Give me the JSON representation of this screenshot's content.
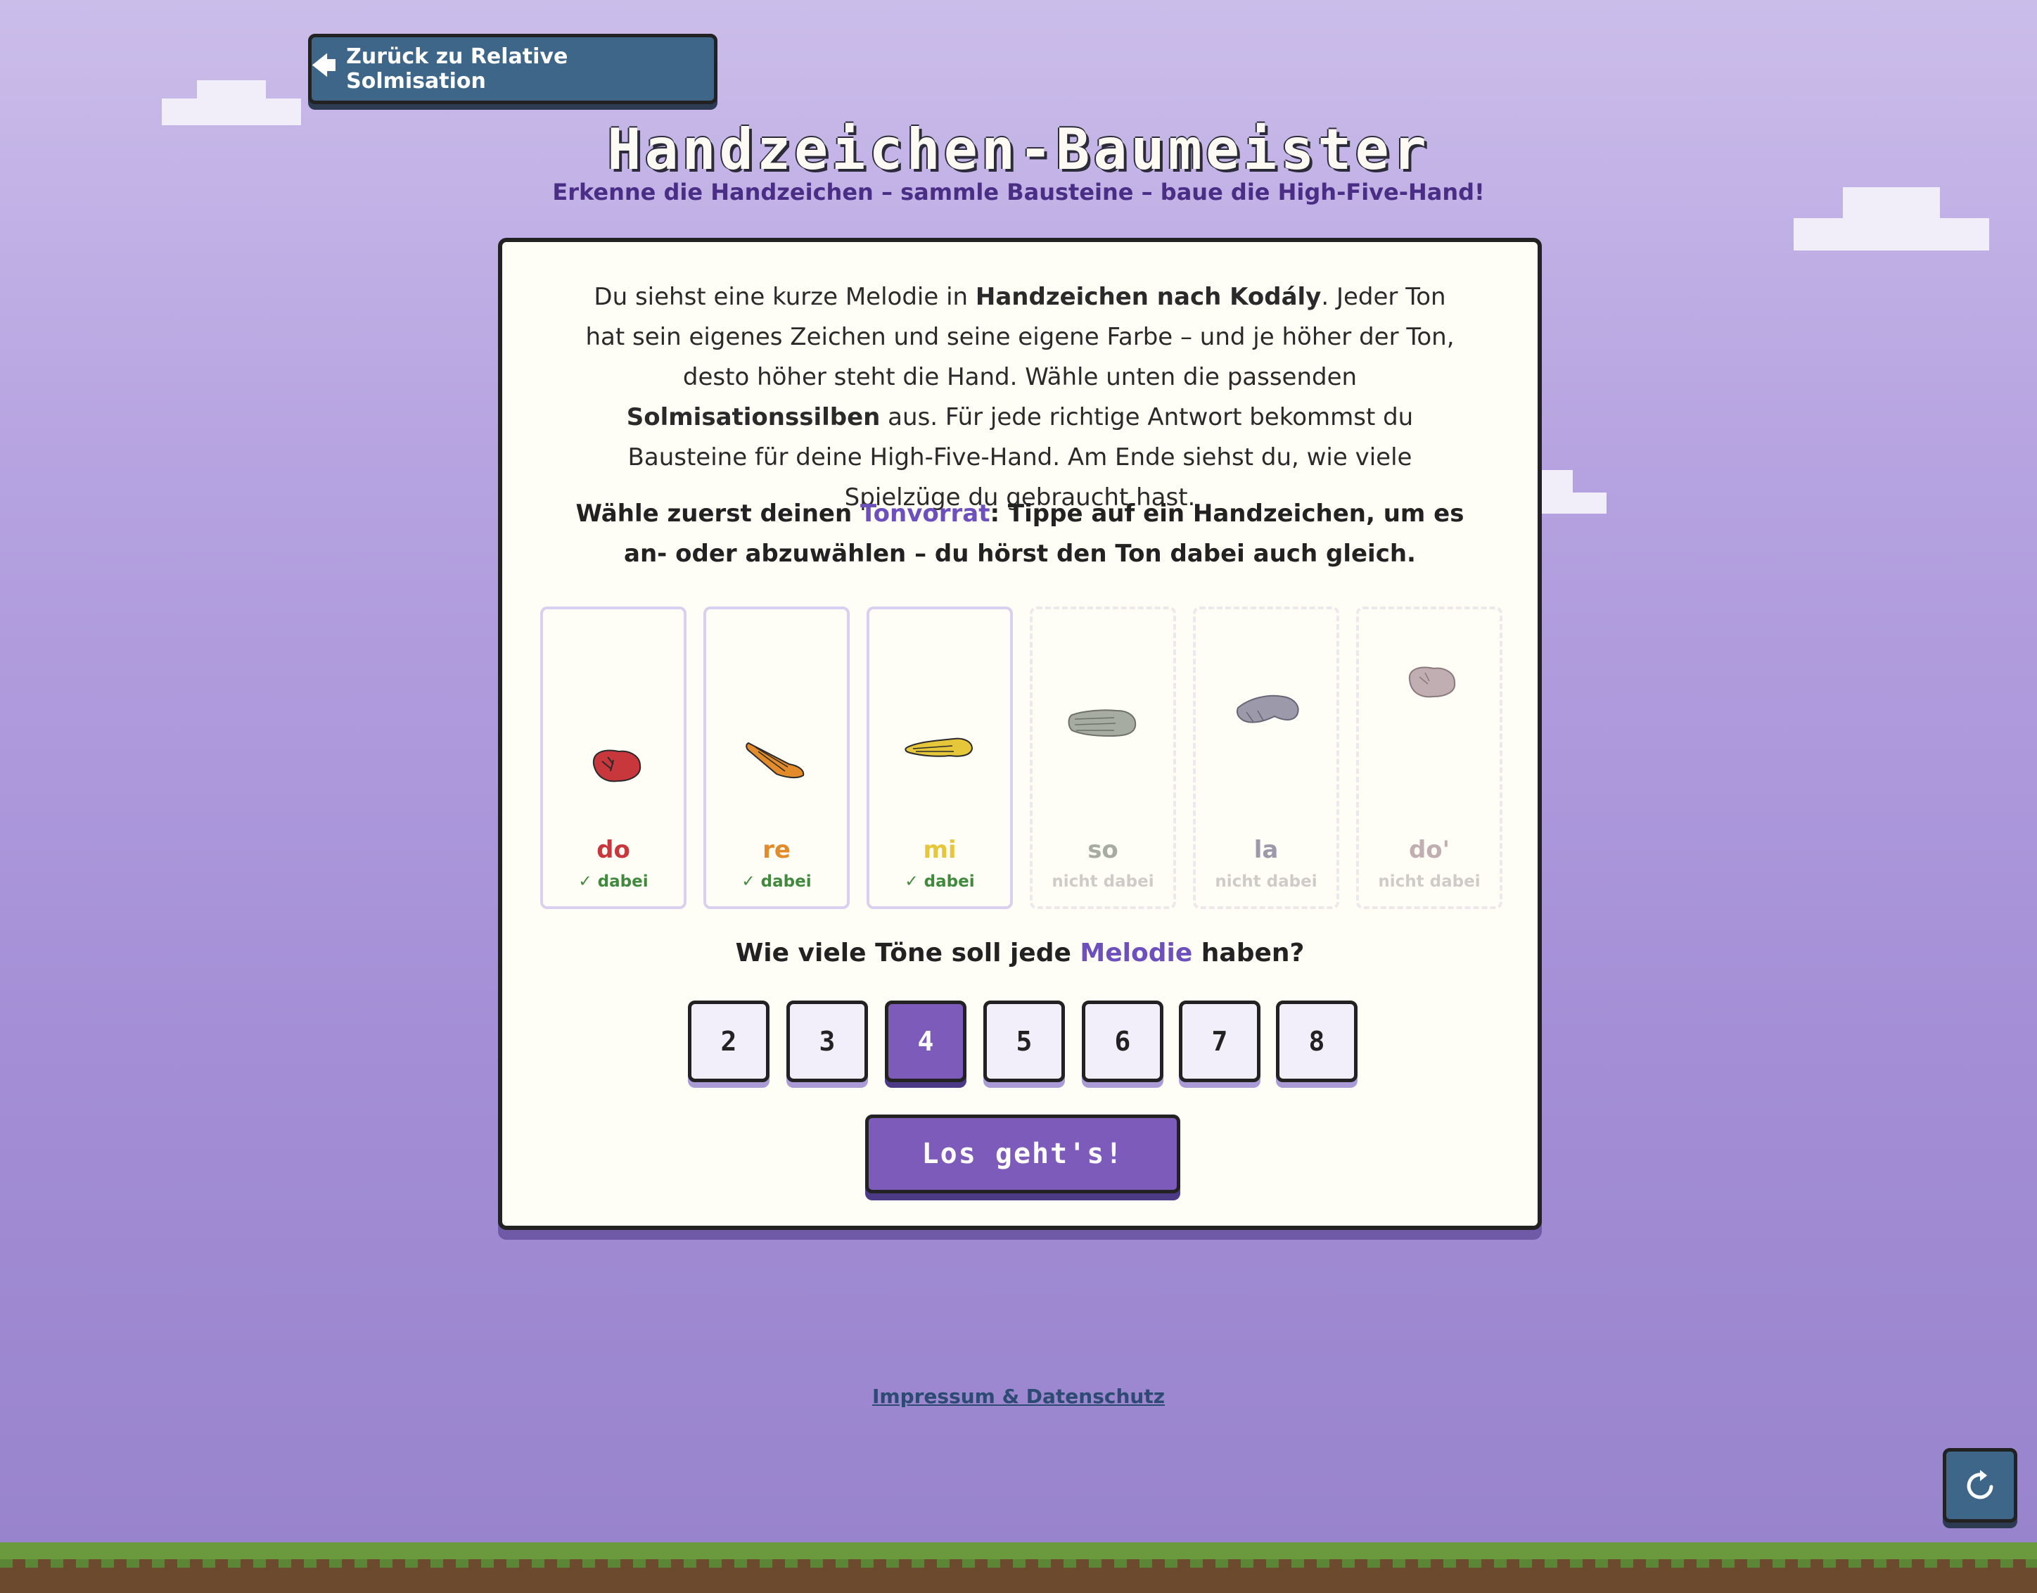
{
  "header": {
    "back_label": "Zurück zu Relative Solmisation",
    "title": "Handzeichen-Baumeister",
    "subtitle": "Erkenne die Handzeichen – sammle Bausteine – baue die High-Five-Hand!"
  },
  "intro": {
    "t1": "Du siehst eine kurze Melodie in ",
    "b1": "Handzeichen nach Kodály",
    "t2": ". Jeder Ton hat sein eigenes Zeichen und seine eigene Farbe – und je höher der Ton, desto höher steht die Hand. Wähle unten die passenden ",
    "b2": "Solmisationssilben",
    "t3": " aus. Für jede richtige Antwort bekommst du Bausteine für deine High-Five-Hand. Am Ende siehst du, wie viele Spielzüge du gebraucht hast."
  },
  "instruction": {
    "t1": "Wähle zuerst deinen ",
    "accent": "Tonvorrat",
    "t2": ": Tippe auf ein Handzeichen, um es an- oder abzuwählen – du hörst den Ton dabei auch gleich."
  },
  "tones": [
    {
      "syllable": "do",
      "status": "dabei",
      "selected": true,
      "color": "#c8373c",
      "icon": "fist-hand-icon"
    },
    {
      "syllable": "re",
      "status": "dabei",
      "selected": true,
      "color": "#e38a2b",
      "icon": "slanted-hand-icon"
    },
    {
      "syllable": "mi",
      "status": "dabei",
      "selected": true,
      "color": "#e6c73a",
      "icon": "flat-hand-icon"
    },
    {
      "syllable": "so",
      "status": "nicht dabei",
      "selected": false,
      "color": "#a6aca2",
      "icon": "open-hand-icon"
    },
    {
      "syllable": "la",
      "status": "nicht dabei",
      "selected": false,
      "color": "#9c9aaa",
      "icon": "drooping-hand-icon"
    },
    {
      "syllable": "do'",
      "status": "nicht dabei",
      "selected": false,
      "color": "#c1aeb2",
      "icon": "high-fist-hand-icon"
    }
  ],
  "length_question": {
    "t1": "Wie viele Töne soll jede ",
    "accent": "Melodie",
    "t2": " haben?"
  },
  "lengths": [
    "2",
    "3",
    "4",
    "5",
    "6",
    "7",
    "8"
  ],
  "selected_length": "4",
  "start_label": "Los geht's!",
  "footer": {
    "link_label": "Impressum & Datenschutz"
  },
  "colors": {
    "accent": "#7d5bbb",
    "back_button": "#3e6689",
    "status_on": "#3f8a3c"
  },
  "icons": {
    "back": "arrow-left-icon",
    "reload": "reload-icon"
  }
}
